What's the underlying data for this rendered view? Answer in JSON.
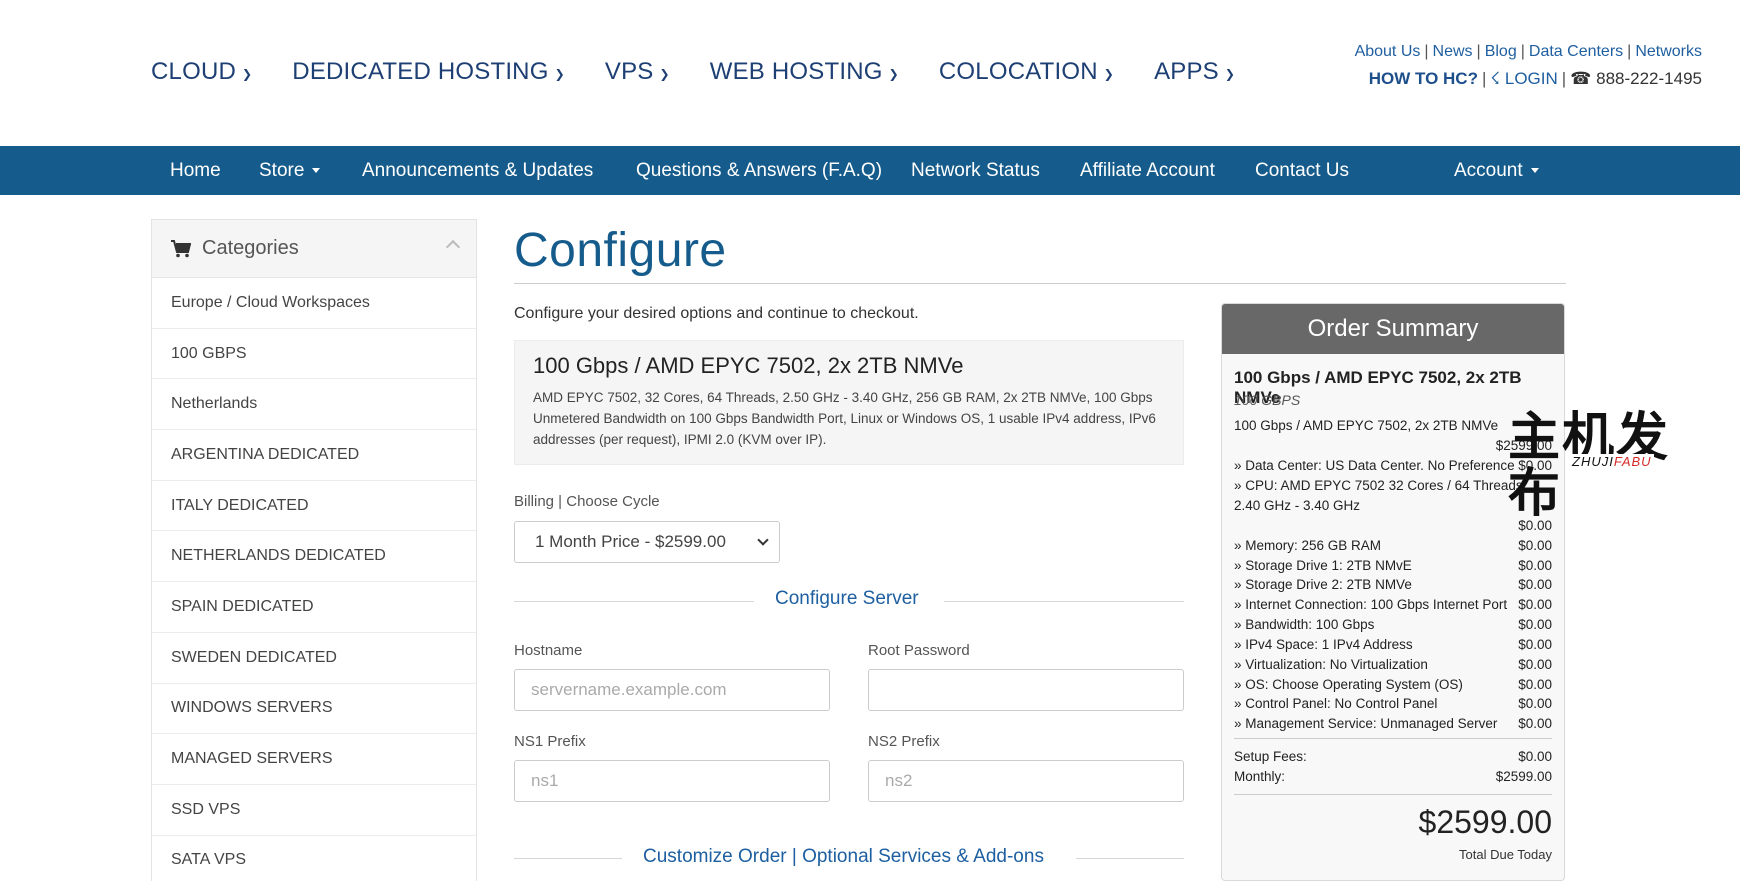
{
  "main_nav": [
    {
      "label": "CLOUD"
    },
    {
      "label": "DEDICATED HOSTING"
    },
    {
      "label": "VPS"
    },
    {
      "label": "WEB HOSTING"
    },
    {
      "label": "COLOCATION"
    },
    {
      "label": "APPS"
    }
  ],
  "top_links": {
    "about": "About Us",
    "news": "News",
    "blog": "Blog",
    "datacenters": "Data Centers",
    "networks": "Networks",
    "howto": "HOW TO HC?",
    "login": "LOGIN",
    "phone": "888-222-1495"
  },
  "navbar": {
    "home": "Home",
    "store": "Store",
    "announcements": "Announcements & Updates",
    "faq": "Questions & Answers (F.A.Q)",
    "network_status": "Network Status",
    "affiliate": "Affiliate Account",
    "contact": "Contact Us",
    "account": "Account"
  },
  "sidebar": {
    "title": "Categories",
    "items": [
      {
        "label": "Europe / Cloud Workspaces"
      },
      {
        "label": "100 GBPS"
      },
      {
        "label": "Netherlands"
      },
      {
        "label": "ARGENTINA DEDICATED"
      },
      {
        "label": "ITALY DEDICATED"
      },
      {
        "label": "NETHERLANDS DEDICATED"
      },
      {
        "label": "SPAIN DEDICATED"
      },
      {
        "label": "SWEDEN DEDICATED"
      },
      {
        "label": "WINDOWS SERVERS"
      },
      {
        "label": "MANAGED SERVERS"
      },
      {
        "label": "SSD VPS"
      },
      {
        "label": "SATA VPS"
      }
    ]
  },
  "main": {
    "title": "Configure",
    "intro": "Configure your desired options and continue to checkout.",
    "product_name": "100 Gbps / AMD EPYC 7502, 2x 2TB NMVe",
    "product_desc": "AMD EPYC 7502, 32 Cores, 64 Threads, 2.50 GHz - 3.40 GHz, 256 GB RAM, 2x 2TB NMVe, 100 Gbps Unmetered Bandwidth on 100 Gbps Bandwidth Port, Linux or Windows OS, 1 usable IPv4 address, IPv6 addresses (per request), IPMI 2.0 (KVM over IP).",
    "billing_label": "Billing | Choose Cycle",
    "billing_value": "1 Month Price - $2599.00",
    "configure_server": "Configure Server",
    "hostname_label": "Hostname",
    "hostname_placeholder": "servername.example.com",
    "root_password_label": "Root Password",
    "ns1_label": "NS1 Prefix",
    "ns1_placeholder": "ns1",
    "ns2_label": "NS2 Prefix",
    "ns2_placeholder": "ns2",
    "customize_order": "Customize Order | Optional Services & Add-ons"
  },
  "summary": {
    "title": "Order Summary",
    "product": "100 Gbps / AMD EPYC 7502, 2x 2TB NMVe",
    "group": "100 GBPS",
    "base_line": "100 Gbps / AMD EPYC 7502, 2x 2TB NMVe",
    "base_amount": "$2599.00",
    "options": [
      {
        "label": "» Data Center: US Data Center. No Preference",
        "amount": "$0.00"
      },
      {
        "label": "» CPU: AMD EPYC 7502 32 Cores / 64 Threads,",
        "amount": ""
      },
      {
        "label": "2.40 GHz - 3.40 GHz",
        "amount": ""
      },
      {
        "label": "",
        "amount": "$0.00"
      },
      {
        "label": "» Memory: 256 GB RAM",
        "amount": "$0.00"
      },
      {
        "label": "» Storage Drive 1: 2TB NMvE",
        "amount": "$0.00"
      },
      {
        "label": "» Storage Drive 2: 2TB NMVe",
        "amount": "$0.00"
      },
      {
        "label": "» Internet Connection: 100 Gbps Internet Port",
        "amount": "$0.00"
      },
      {
        "label": "» Bandwidth: 100 Gbps",
        "amount": "$0.00"
      },
      {
        "label": "» IPv4 Space: 1 IPv4 Address",
        "amount": "$0.00"
      },
      {
        "label": "» Virtualization: No Virtualization",
        "amount": "$0.00"
      },
      {
        "label": "» OS: Choose Operating System (OS)",
        "amount": "$0.00"
      },
      {
        "label": "» Control Panel: No Control Panel",
        "amount": "$0.00"
      },
      {
        "label": "» Management Service: Unmanaged Server",
        "amount": "$0.00"
      }
    ],
    "setup_label": "Setup Fees:",
    "setup_amount": "$0.00",
    "monthly_label": "Monthly:",
    "monthly_amount": "$2599.00",
    "total": "$2599.00",
    "total_label": "Total Due Today"
  },
  "watermark": {
    "cn": "主机发布",
    "en_a": "ZHUJI",
    "en_b": "FABU"
  },
  "colors": {
    "navbar": "#155b8b",
    "title": "#155b8b",
    "summary_header": "#686868"
  }
}
